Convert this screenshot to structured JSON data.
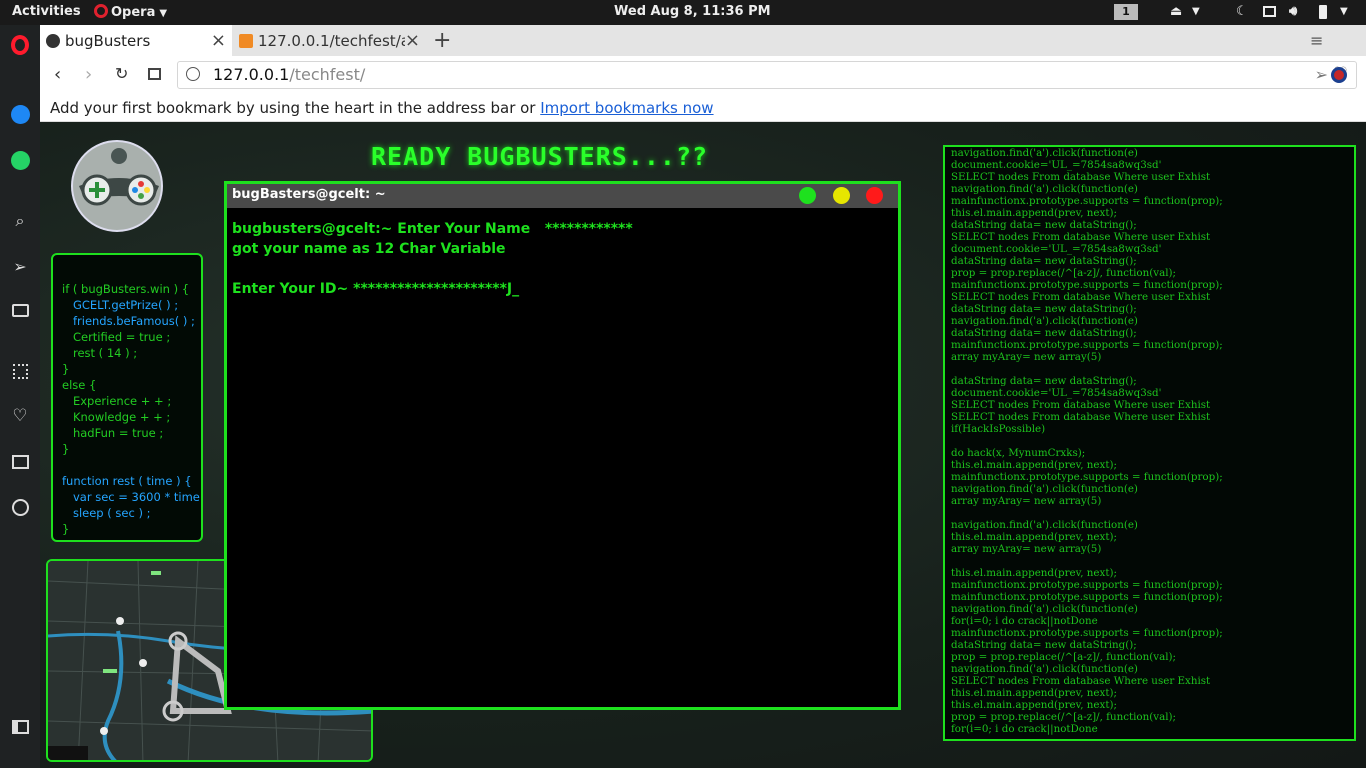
{
  "topbar": {
    "activities": "Activities",
    "app": "Opera",
    "clock": "Wed Aug  8, 11:36 PM",
    "workspace": "1"
  },
  "tabs": [
    {
      "title": "bugBusters",
      "close": "×"
    },
    {
      "title": "127.0.0.1/techfest/a",
      "close": "×"
    }
  ],
  "new_tab": "+",
  "address": {
    "host": "127.0.0.1",
    "path": "/techfest/"
  },
  "bookmarks_bar": {
    "text": "Add your first bookmark by using the heart in the address bar or ",
    "link": "Import bookmarks now"
  },
  "page": {
    "heading": "READY BUGBUSTERS...??",
    "terminal": {
      "title": "bugBasters@gcelt: ~",
      "line1": "bugbusters@gcelt:~ Enter Your Name   ************",
      "line2": "got your name as 12 Char Variable",
      "line3": "Enter Your ID~ *********************J_",
      "buttons": {
        "green": "#1ee11e",
        "yellow": "#e6e600",
        "red": "#ff1a1a"
      }
    },
    "code_lines": [
      "if ( bugBusters.win ) {",
      "   GCELT.getPrize( ) ;",
      "   friends.beFamous( ) ;",
      "   Certified = true ;",
      "   rest ( 14 ) ;",
      "}",
      "else {",
      "   Experience + + ;",
      "   Knowledge + + ;",
      "   hadFun = true ;",
      "}",
      "",
      "function rest ( time ) {",
      "   var sec = 3600 * time ;",
      "   sleep ( sec ) ;",
      "}"
    ],
    "log_lines": [
      "navigation.find('a').click(function(e)",
      "document.cookie='UL_=7854sa8wq3sd'",
      "SELECT nodes From database Where user Exhist",
      "navigation.find('a').click(function(e)",
      "mainfunctionx.prototype.supports = function(prop);",
      "this.el.main.append(prev, next);",
      "dataString data= new dataString();",
      "SELECT nodes From database Where user Exhist",
      "document.cookie='UL_=7854sa8wq3sd'",
      "dataString data= new dataString();",
      "prop = prop.replace(/^[a-z]/, function(val);",
      "mainfunctionx.prototype.supports = function(prop);",
      "SELECT nodes From database Where user Exhist",
      "dataString data= new dataString();",
      "navigation.find('a').click(function(e)",
      "dataString data= new dataString();",
      "mainfunctionx.prototype.supports = function(prop);",
      "array myAray= new array(5)",
      "",
      "dataString data= new dataString();",
      "document.cookie='UL_=7854sa8wq3sd'",
      "SELECT nodes From database Where user Exhist",
      "SELECT nodes From database Where user Exhist",
      "if(HackIsPossible)",
      "",
      "do hack(x, MynumCrxks);",
      "this.el.main.append(prev, next);",
      "mainfunctionx.prototype.supports = function(prop);",
      "navigation.find('a').click(function(e)",
      "array myAray= new array(5)",
      "",
      "navigation.find('a').click(function(e)",
      "this.el.main.append(prev, next);",
      "array myAray= new array(5)",
      "",
      "this.el.main.append(prev, next);",
      "mainfunctionx.prototype.supports = function(prop);",
      "mainfunctionx.prototype.supports = function(prop);",
      "navigation.find('a').click(function(e)",
      "for(i=0; i do crack||notDone",
      "mainfunctionx.prototype.supports = function(prop);",
      "dataString data= new dataString();",
      "prop = prop.replace(/^[a-z]/, function(val);",
      "navigation.find('a').click(function(e)",
      "SELECT nodes From database Where user Exhist",
      "this.el.main.append(prev, next);",
      "this.el.main.append(prev, next);",
      "prop = prop.replace(/^[a-z]/, function(val);",
      "for(i=0; i do crack||notDone"
    ]
  }
}
